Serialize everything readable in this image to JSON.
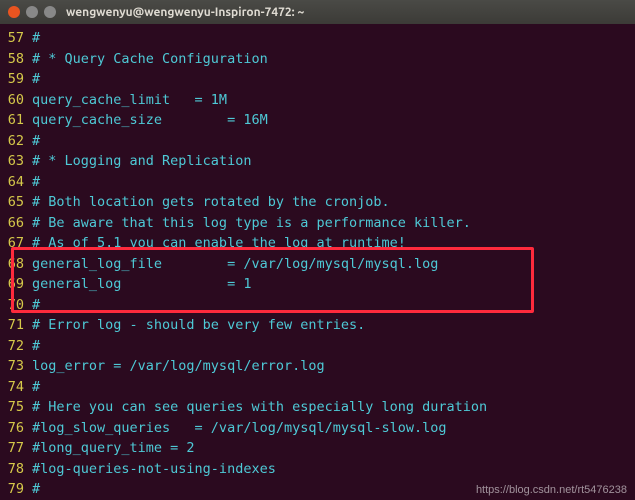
{
  "window": {
    "title": "wengwenyu@wengwenyu-Inspiron-7472: ~"
  },
  "lines": [
    {
      "n": "57",
      "t": "#"
    },
    {
      "n": "58",
      "t": "# * Query Cache Configuration"
    },
    {
      "n": "59",
      "t": "#"
    },
    {
      "n": "60",
      "t": "query_cache_limit   = 1M"
    },
    {
      "n": "61",
      "t": "query_cache_size        = 16M"
    },
    {
      "n": "62",
      "t": "#"
    },
    {
      "n": "63",
      "t": "# * Logging and Replication"
    },
    {
      "n": "64",
      "t": "#"
    },
    {
      "n": "65",
      "t": "# Both location gets rotated by the cronjob."
    },
    {
      "n": "66",
      "t": "# Be aware that this log type is a performance killer."
    },
    {
      "n": "67",
      "t": "# As of 5.1 you can enable the log at runtime!"
    },
    {
      "n": "68",
      "t": "general_log_file        = /var/log/mysql/mysql.log"
    },
    {
      "n": "69",
      "t": "general_log             = 1"
    },
    {
      "n": "70",
      "t": "#"
    },
    {
      "n": "71",
      "t": "# Error log - should be very few entries."
    },
    {
      "n": "72",
      "t": "#"
    },
    {
      "n": "73",
      "t": "log_error = /var/log/mysql/error.log"
    },
    {
      "n": "74",
      "t": "#"
    },
    {
      "n": "75",
      "t": "# Here you can see queries with especially long duration"
    },
    {
      "n": "76",
      "t": "#log_slow_queries   = /var/log/mysql/mysql-slow.log"
    },
    {
      "n": "77",
      "t": "#long_query_time = 2"
    },
    {
      "n": "78",
      "t": "#log-queries-not-using-indexes"
    },
    {
      "n": "79",
      "t": "#"
    }
  ],
  "watermark": "https://blog.csdn.net/rt5476238"
}
